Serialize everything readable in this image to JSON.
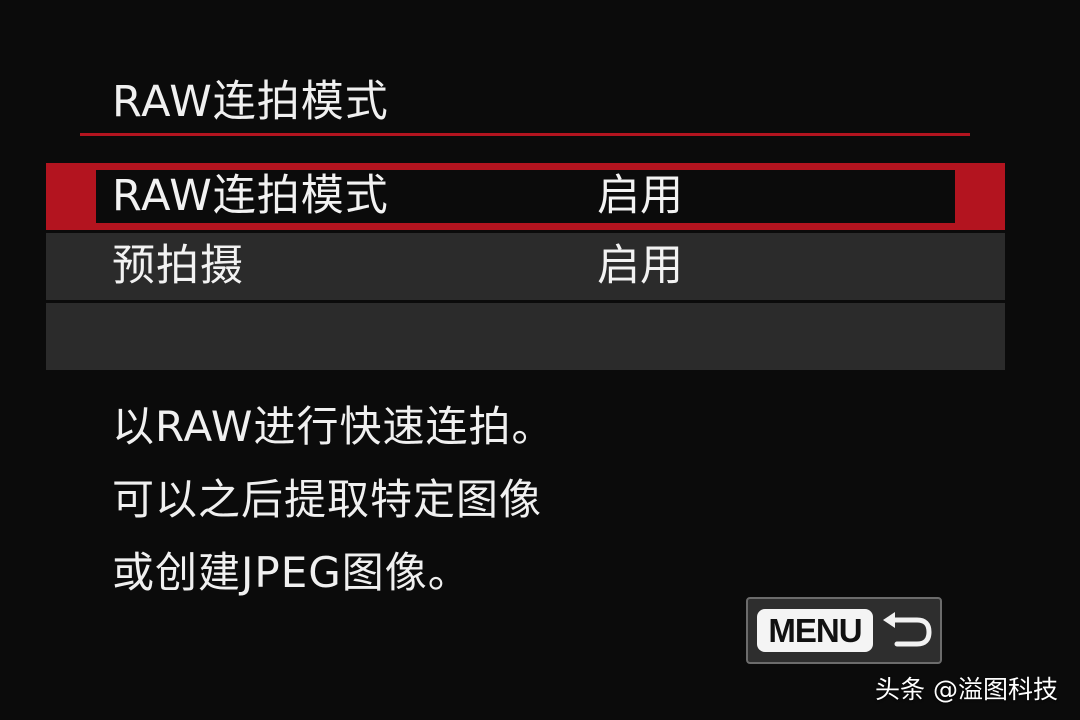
{
  "screen": {
    "title": "RAW连拍模式"
  },
  "menu": {
    "items": [
      {
        "label": "RAW连拍模式",
        "value": "启用",
        "selected": true
      },
      {
        "label": "预拍摄",
        "value": "启用",
        "selected": false
      },
      {
        "label": "",
        "value": "",
        "selected": false
      }
    ]
  },
  "description": {
    "lines": [
      "以RAW进行快速连拍。",
      "可以之后提取特定图像",
      "或创建JPEG图像。"
    ]
  },
  "footer": {
    "menu_button_label": "MENU",
    "back_icon": "return-arrow-icon"
  },
  "watermark": {
    "text": "头条 @溢图科技"
  },
  "colors": {
    "accent": "#b3141f",
    "background": "#0b0b0b",
    "row_background": "#2b2b2b",
    "text": "#f2f2f2"
  }
}
